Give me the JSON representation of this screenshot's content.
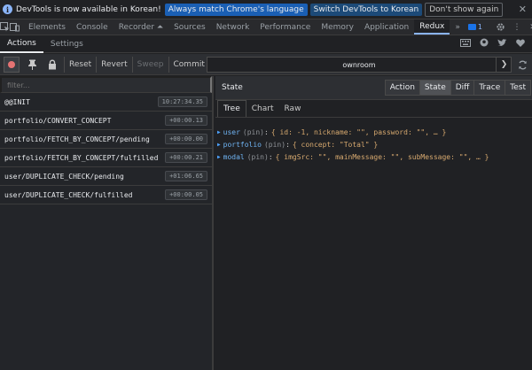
{
  "infobar": {
    "message": "DevTools is now available in Korean!",
    "buttons": [
      "Always match Chrome's language",
      "Switch DevTools to Korean",
      "Don't show again"
    ],
    "close_icon": "close-icon"
  },
  "tabbar": {
    "tabs": [
      {
        "label": "Elements",
        "active": false
      },
      {
        "label": "Console",
        "active": false
      },
      {
        "label": "Recorder ⏶",
        "active": false
      },
      {
        "label": "Sources",
        "active": false
      },
      {
        "label": "Network",
        "active": false
      },
      {
        "label": "Performance",
        "active": false
      },
      {
        "label": "Memory",
        "active": false
      },
      {
        "label": "Application",
        "active": false
      },
      {
        "label": "Redux",
        "active": true
      }
    ],
    "overflow": "»",
    "issues_count": "1"
  },
  "redux_header": {
    "tabs": [
      {
        "label": "Actions",
        "active": true
      },
      {
        "label": "Settings",
        "active": false
      }
    ]
  },
  "toolbar": {
    "reset": "Reset",
    "revert": "Revert",
    "sweep": "Sweep",
    "commit": "Commit",
    "instance": "ownroom"
  },
  "actions": {
    "filter_placeholder": "filter...",
    "items": [
      {
        "name": "@@INIT",
        "time": "10:27:34.35"
      },
      {
        "name": "portfolio/CONVERT_CONCEPT",
        "time": "+00:00.13"
      },
      {
        "name": "portfolio/FETCH_BY_CONCEPT/pending",
        "time": "+00:00.00"
      },
      {
        "name": "portfolio/FETCH_BY_CONCEPT/fulfilled",
        "time": "+00:00.21"
      },
      {
        "name": "user/DUPLICATE_CHECK/pending",
        "time": "+01:06.65"
      },
      {
        "name": "user/DUPLICATE_CHECK/fulfilled",
        "time": "+00:00.05"
      }
    ]
  },
  "inspector": {
    "title": "State",
    "mode_tabs": [
      {
        "label": "Action",
        "active": false
      },
      {
        "label": "State",
        "active": true
      },
      {
        "label": "Diff",
        "active": false
      },
      {
        "label": "Trace",
        "active": false
      },
      {
        "label": "Test",
        "active": false
      }
    ],
    "sub_tabs": [
      {
        "label": "Tree",
        "active": true
      },
      {
        "label": "Chart",
        "active": false
      },
      {
        "label": "Raw",
        "active": false
      }
    ],
    "tree": [
      {
        "key": "user",
        "pin": "(pin)",
        "value": "{ id: -1, nickname: \"\", password: \"\", … }"
      },
      {
        "key": "portfolio",
        "pin": "(pin)",
        "value": "{ concept: \"Total\" }"
      },
      {
        "key": "modal",
        "pin": "(pin)",
        "value": "{ imgSrc: \"\", mainMessage: \"\", subMessage: \"\", … }"
      }
    ]
  }
}
